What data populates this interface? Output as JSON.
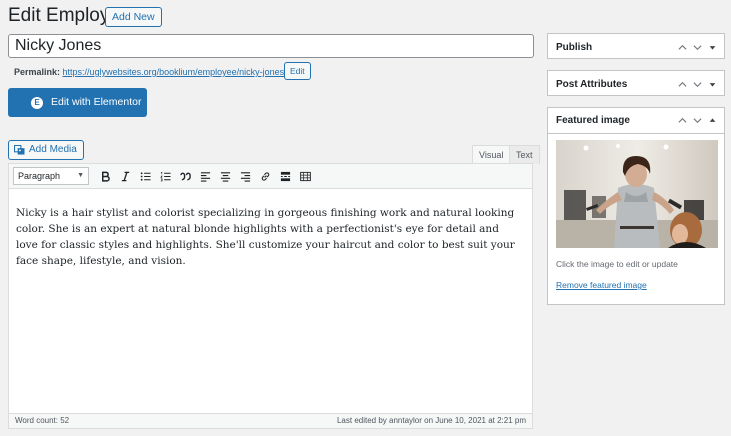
{
  "header": {
    "title": "Edit Employee",
    "add_new_label": "Add New"
  },
  "post": {
    "title": "Nicky Jones",
    "permalink_label": "Permalink:",
    "permalink_url": "https://uglywebsites.org/booklium/employee/nicky-jones-2/",
    "permalink_edit_label": "Edit"
  },
  "elementor": {
    "button_label": "Edit with Elementor",
    "logo_glyph": "E"
  },
  "editor": {
    "add_media_label": "Add Media",
    "tabs": [
      {
        "label": "Visual",
        "active": true
      },
      {
        "label": "Text",
        "active": false
      }
    ],
    "format_value": "Paragraph",
    "toolbar_icons": [
      "bold-icon",
      "italic-icon",
      "bulleted-list-icon",
      "numbered-list-icon",
      "blockquote-icon",
      "align-left-icon",
      "align-center-icon",
      "align-right-icon",
      "link-icon",
      "read-more-icon",
      "toolbar-toggle-icon"
    ],
    "content": "Nicky is a hair stylist and colorist specializing in gorgeous finishing work and natural looking color. She is an expert at natural blonde highlights with a perfectionist's eye for detail and love for classic styles and highlights. She'll customize your haircut and color to best suit your face shape, lifestyle, and vision.",
    "word_count": "Word count: 52",
    "last_edited": "Last edited by anntaylor on June 10, 2021 at 2:21 pm"
  },
  "sidebar": {
    "publish": {
      "title": "Publish"
    },
    "post_attributes": {
      "title": "Post Attributes"
    },
    "featured_image": {
      "title": "Featured image",
      "hint": "Click the image to edit or update",
      "remove_label": "Remove featured image"
    }
  },
  "colors": {
    "accent": "#2271b1",
    "background": "#f1f1f1"
  }
}
